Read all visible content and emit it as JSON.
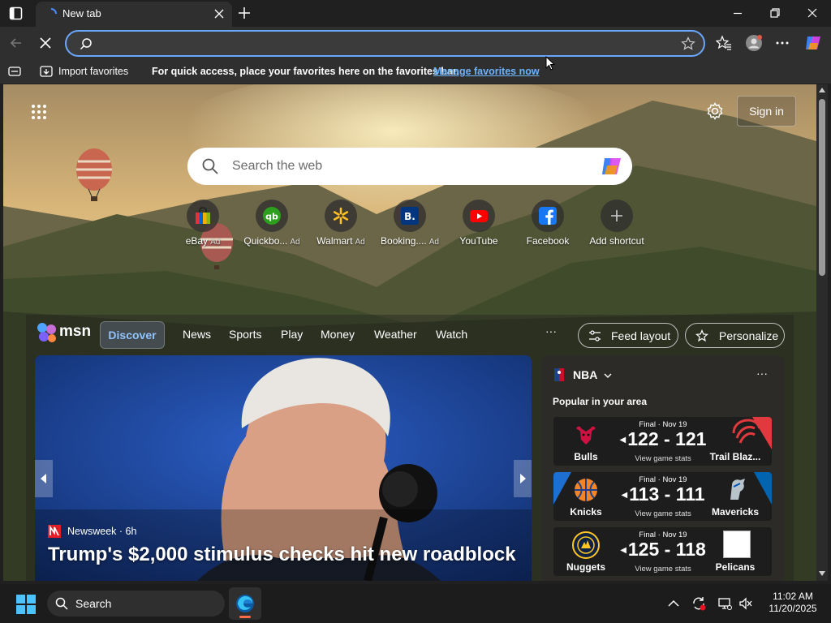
{
  "browser": {
    "tab_title": "New tab",
    "favorites_bar": {
      "import_label": "Import favorites",
      "hint_text": "For quick access, place your favorites here on the favorites bar.",
      "manage_link": "Manage favorites now"
    }
  },
  "newtab": {
    "signin_label": "Sign in",
    "search_placeholder": "Search the web",
    "shortcuts": [
      {
        "label": "eBay",
        "ad": "Ad",
        "icon": "ebay-icon"
      },
      {
        "label": "Quickbo...",
        "ad": "Ad",
        "icon": "quickbooks-icon"
      },
      {
        "label": "Walmart",
        "ad": "Ad",
        "icon": "walmart-icon"
      },
      {
        "label": "Booking....",
        "ad": "Ad",
        "icon": "booking-icon"
      },
      {
        "label": "YouTube",
        "ad": "",
        "icon": "youtube-icon"
      },
      {
        "label": "Facebook",
        "ad": "",
        "icon": "facebook-icon"
      },
      {
        "label": "Add shortcut",
        "ad": "",
        "icon": "plus-icon"
      }
    ]
  },
  "msn": {
    "logo_text": "msn",
    "nav": [
      "Discover",
      "News",
      "Sports",
      "Play",
      "Money",
      "Weather",
      "Watch"
    ],
    "more": "···",
    "feed_layout_label": "Feed layout",
    "personalize_label": "Personalize",
    "hero": {
      "source": "Newsweek · 6h",
      "headline": "Trump's $2,000 stimulus checks hit new roadblock"
    },
    "nba": {
      "title": "NBA",
      "more": "···",
      "subtitle": "Popular in your area",
      "games": [
        {
          "status": "Final · Nov 19",
          "home": "Bulls",
          "away": "Trail Blaz...",
          "score": "122 - 121",
          "stats_label": "View game stats"
        },
        {
          "status": "Final · Nov 19",
          "home": "Knicks",
          "away": "Mavericks",
          "score": "113 - 111",
          "stats_label": "View game stats"
        },
        {
          "status": "Final · Nov 19",
          "home": "Nuggets",
          "away": "Pelicans",
          "score": "125 - 118",
          "stats_label": "View game stats"
        }
      ]
    }
  },
  "taskbar": {
    "search_label": "Search",
    "time": "11:02 AM",
    "date": "11/20/2025"
  },
  "colors": {
    "accent": "#6aa7ff",
    "link": "#6cb4ff",
    "edge_indicator": "#ff6b4a"
  }
}
